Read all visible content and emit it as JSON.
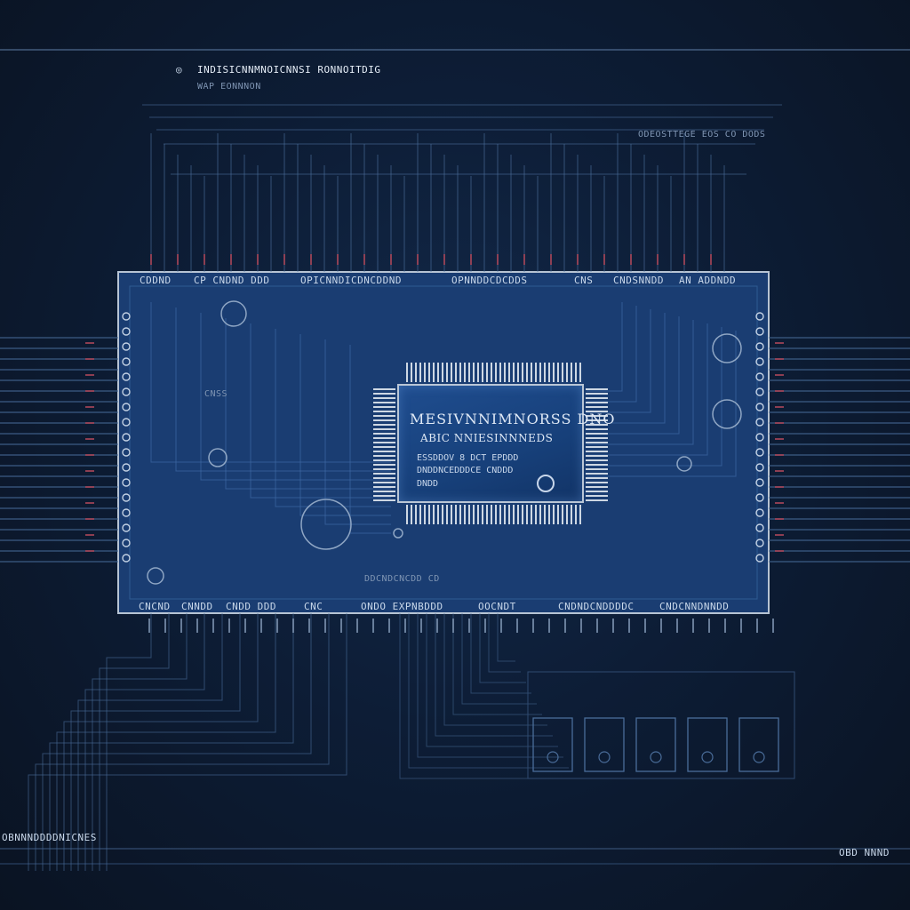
{
  "header": {
    "title": "INDISICNNMNOICNNSI RONNOITDIG",
    "subtitle": "WAP EONNNON",
    "right_label": "ODEOSTTEGE EOS CO DODS"
  },
  "board": {
    "top_labels": [
      "CDDND",
      "CP CNDND DDD",
      "OPICNNDICDNCDDND",
      "OPNNDDCDCDDS",
      "CNS",
      "CNDSNNDD",
      "AN ADDNDD"
    ],
    "bottom_labels": [
      "CNCND",
      "CNNDD",
      "CNDD DDD",
      "CNC",
      "ONDO EXPNBDDD",
      "OOCNDT",
      "CNDNDCNDDDDC",
      "CNDCNNDNNDD"
    ],
    "mid_label_left": "CNSS",
    "mid_label_right": "DDCNDCNCDD CD"
  },
  "chip": {
    "title": "MESIVNNIMNORSS DNO",
    "subtitle": "ABIC NNIESINNNEDS",
    "line1": "ESSDDOV 8 DCT EPDDD",
    "line2": "DNDDNCEDDDCE CNDDD",
    "line3": "DNDD"
  },
  "footer": {
    "left_label": "OBNNNDDDDNICNES",
    "right_label": "OBD NNND"
  },
  "colors": {
    "background": "#0b1526",
    "board": "#1a3d72",
    "trace": "#4a6d9a",
    "accent_red": "#b84a5c"
  }
}
